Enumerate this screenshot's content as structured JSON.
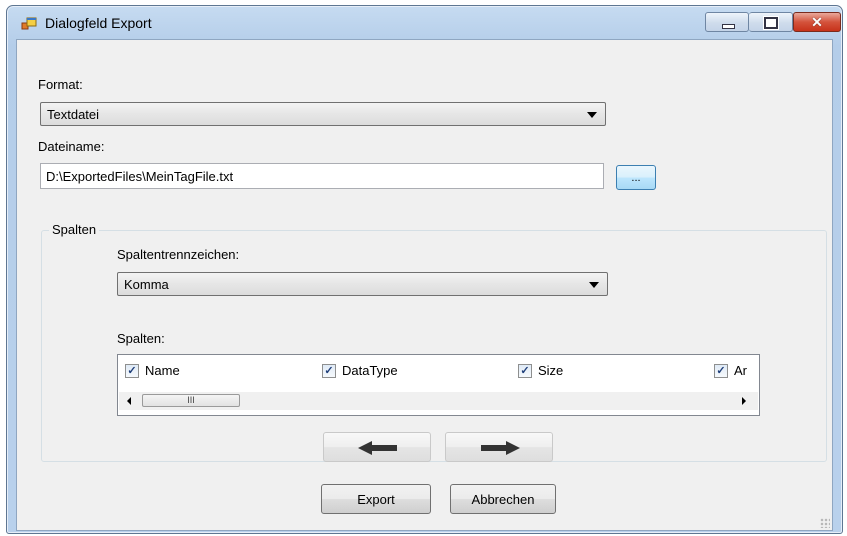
{
  "window": {
    "title": "Dialogfeld Export",
    "icon": "dialog-app-icon",
    "controls": {
      "minimize": "minimize-icon",
      "maximize": "maximize-icon",
      "close": "✕"
    }
  },
  "format": {
    "label": "Format:",
    "selected": "Textdatei"
  },
  "filename": {
    "label": "Dateiname:",
    "value": "D:\\ExportedFiles\\MeinTagFile.txt",
    "browse_label": "..."
  },
  "columns_group": {
    "title": "Spalten",
    "separator_label": "Spaltentrennzeichen:",
    "separator_selected": "Komma",
    "columns_label": "Spalten:",
    "items": [
      {
        "label": "Name",
        "checked": true,
        "check": "✓"
      },
      {
        "label": "DataType",
        "checked": true,
        "check": "✓"
      },
      {
        "label": "Size",
        "checked": true,
        "check": "✓"
      },
      {
        "label": "Ar",
        "checked": true,
        "check": "✓"
      }
    ],
    "scroll_thumb": "III",
    "move_left_icon": "arrow-left-icon",
    "move_right_icon": "arrow-right-icon"
  },
  "buttons": {
    "export": "Export",
    "cancel": "Abbrechen"
  },
  "colors": {
    "titlebar": "#b9d1ec",
    "client_bg": "#f0f0f0",
    "close_button": "#c7321a",
    "checkmark": "#1f3f7a"
  }
}
